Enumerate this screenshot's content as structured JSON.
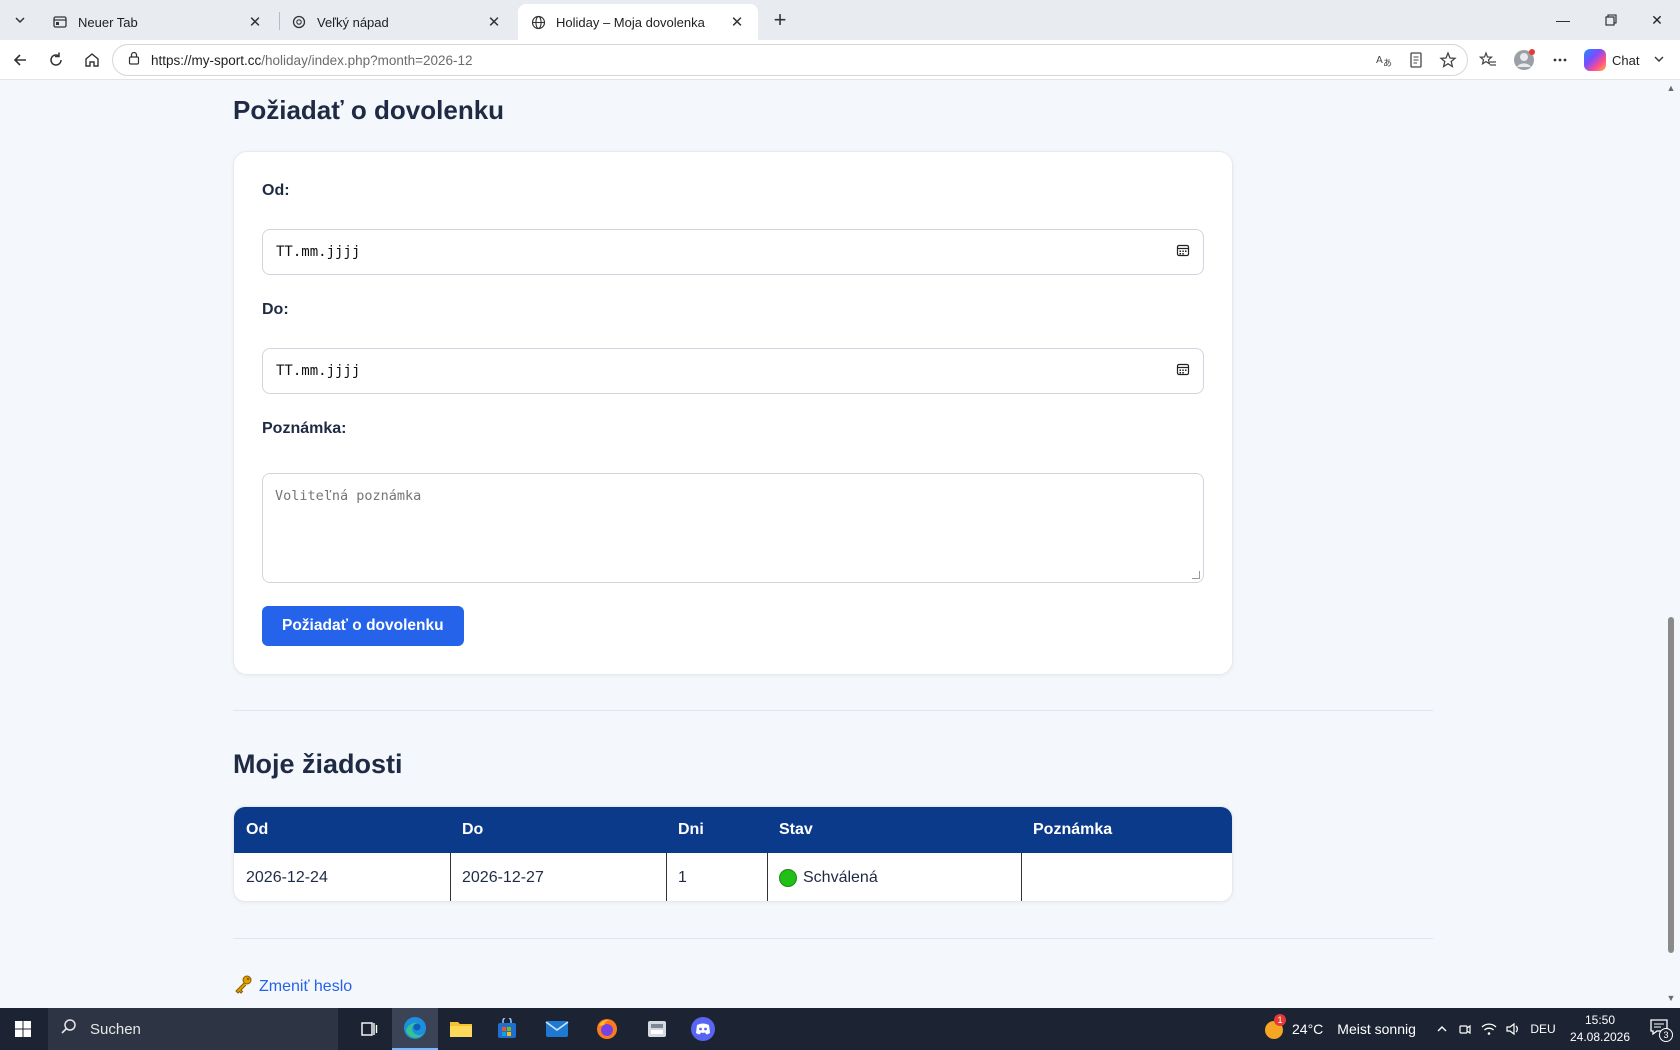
{
  "browser": {
    "tabs": [
      {
        "title": "Neuer Tab",
        "icon": "new-tab-page-icon",
        "active": false
      },
      {
        "title": "Veľký nápad",
        "icon": "openai-icon",
        "active": false
      },
      {
        "title": "Holiday – Moja dovolenka",
        "icon": "globe-icon",
        "active": true
      }
    ],
    "url_host": "https://my-sport.cc",
    "url_rest": "/holiday/index.php?month=2026-12",
    "chat_label": "Chat"
  },
  "form": {
    "heading": "Požiadať o dovolenku",
    "from_label": "Od:",
    "from_value": "TT.mm.jjjj",
    "to_label": "Do:",
    "to_value": "TT.mm.jjjj",
    "note_label": "Poznámka:",
    "note_placeholder": "Voliteľná poznámka",
    "submit_label": "Požiadať o dovolenku"
  },
  "requests": {
    "heading": "Moje žiadosti",
    "columns": [
      "Od",
      "Do",
      "Dni",
      "Stav",
      "Poznámka"
    ],
    "rows": [
      {
        "from": "2026-12-24",
        "to": "2026-12-27",
        "days": "1",
        "status": "Schválená",
        "status_color": "#22c017",
        "note": ""
      }
    ]
  },
  "footer_link": {
    "icon": "key-icon",
    "label": "Zmeniť heslo"
  },
  "taskbar": {
    "search_label": "Suchen",
    "weather_temp": "24°C",
    "weather_text": "Meist sonnig",
    "weather_badge": "1",
    "language": "DEU",
    "time": "15:50",
    "date": "24.08.2026",
    "notification_count": "3"
  }
}
